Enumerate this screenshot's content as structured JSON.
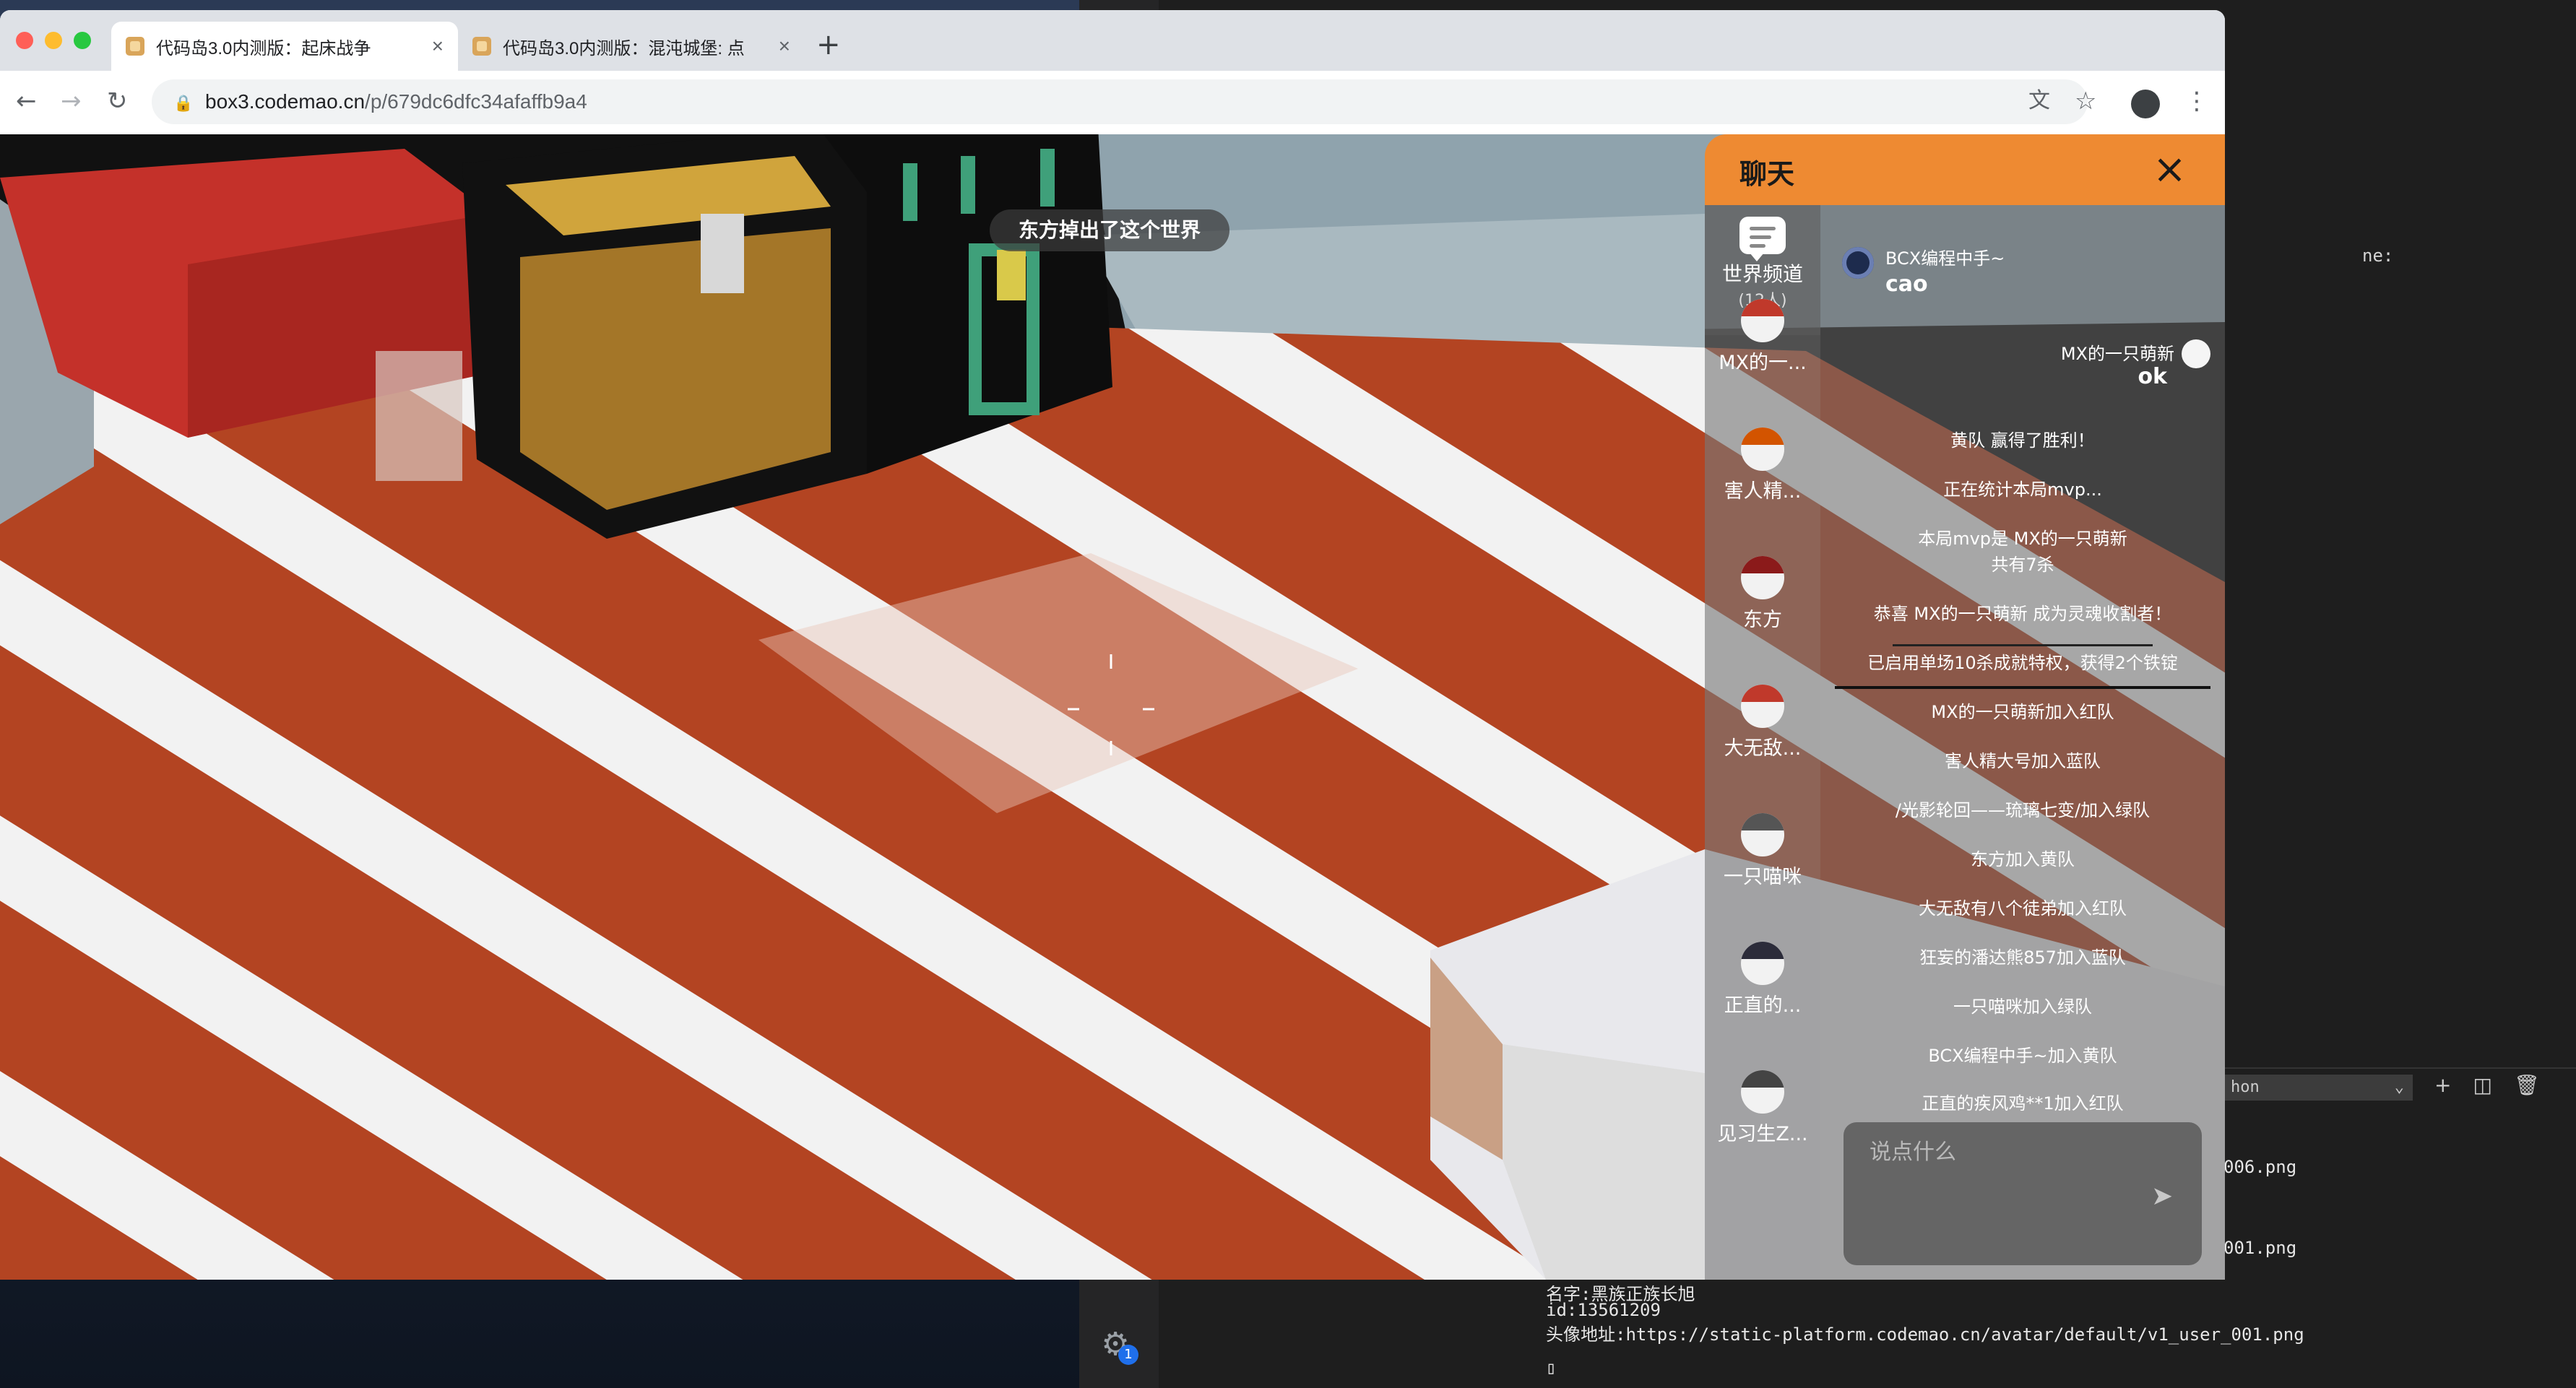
{
  "browser": {
    "tabs": [
      {
        "label": "代码岛3.0内测版：起床战争",
        "active": true
      },
      {
        "label": "代码岛3.0内测版：混沌城堡: 点",
        "active": false
      }
    ],
    "url_host": "box3.codemao.cn",
    "url_path": "/p/679dc6dfc34afaffb9a4"
  },
  "game": {
    "toast": "东方掉出了这个世界"
  },
  "chat": {
    "title": "聊天",
    "channel": {
      "label": "世界频道",
      "count": "(12人)"
    },
    "users": [
      {
        "name": "MX的一...",
        "hair": "#d9d9d9",
        "accent": "#c0392b"
      },
      {
        "name": "害人精...",
        "hair": "#333a55",
        "accent": "#d35400"
      },
      {
        "name": "东方",
        "hair": "#8b1a1a",
        "accent": "#8b1a1a"
      },
      {
        "name": "大无敌...",
        "hair": "#ffffff",
        "accent": "#c0392b"
      },
      {
        "name": "一只喵咪",
        "hair": "#e8e8e8",
        "accent": "#555555"
      },
      {
        "name": "正直的...",
        "hair": "#2c2c3a",
        "accent": "#2c2c3a"
      },
      {
        "name": "见习生Z...",
        "hair": "#e8e8e8",
        "accent": "#444444"
      }
    ],
    "messages": [
      {
        "user": "BCX编程中手~",
        "text": "cao"
      },
      {
        "user": "MX的一只萌新",
        "text": "ok"
      }
    ],
    "system": [
      "黄队 赢得了胜利！",
      "正在统计本局mvp...",
      "本局mvp是 MX的一只萌新",
      "共有7杀",
      "恭喜 MX的一只萌新 成为灵魂收割者！",
      "已启用单场10杀成就特权，获得2个铁锭",
      "MX的一只萌新加入红队",
      "害人精大号加入蓝队",
      "/光影轮回——琉璃七变/加入绿队",
      "东方加入黄队",
      "大无敌有八个徒弟加入红队",
      "狂妄的潘达熊857加入蓝队",
      "一只喵咪加入绿队",
      "BCX编程中手~加入黄队",
      "正直的疾风鸡**1加入红队"
    ],
    "input_placeholder": "说点什么"
  },
  "ide": {
    "terminal_select": "hon",
    "fragments": [
      "006.png",
      "001.png"
    ],
    "terminal_lines": [
      "名字:黑族正族长旭",
      "id:13561209",
      "头像地址:https://static-platform.codemao.cn/avatar/default/v1_user_001.png"
    ],
    "side_fragment": "ne:",
    "badge": "1"
  }
}
